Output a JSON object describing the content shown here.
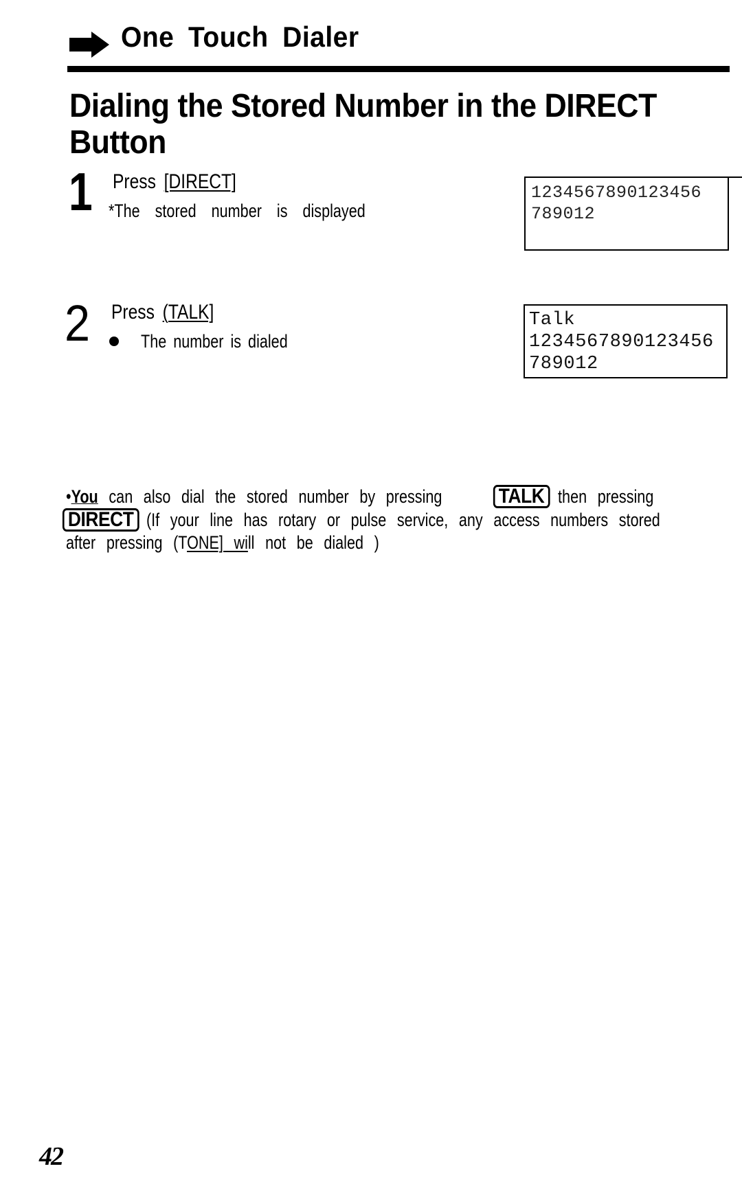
{
  "header": {
    "section_icon": "arrow-right-icon",
    "section_title": "One Touch Dialer"
  },
  "page_heading": "Dialing the Stored Number in the DIRECT Button",
  "steps": [
    {
      "number": "1",
      "press_label": "Press",
      "key": "[DIRECT]",
      "note": "*The stored number is displayed",
      "display": [
        "1234567890123456",
        "789012"
      ]
    },
    {
      "number": "2",
      "press_label": "Press",
      "key": "(TALK]",
      "note": "The number is dialed",
      "display": [
        "Talk",
        "1234567890123456",
        "789012"
      ]
    }
  ],
  "tip": {
    "bullet": "•",
    "you": "You",
    "line1_a": "can also dial the stored number by pressing",
    "key_talk": "TALK",
    "line1_b": "then pressing",
    "key_direct": "DIRECT",
    "line2": "(If your line has rotary or pulse service, any access numbers stored",
    "line3_a": "after pressing (T",
    "line3_u": "ONE] wi",
    "line3_b": "ll not be dialed )"
  },
  "page_number": "42"
}
